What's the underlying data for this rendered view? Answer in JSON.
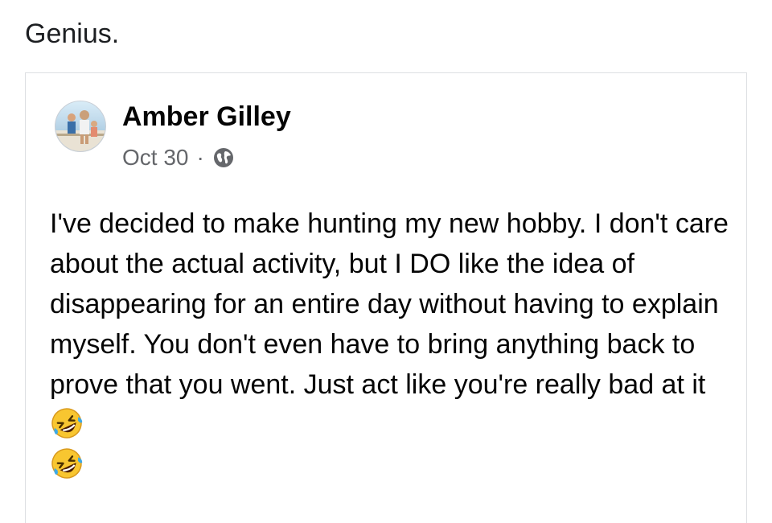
{
  "caption": "Genius.",
  "post": {
    "author": "Amber Gilley",
    "date": "Oct 30",
    "separator": "·",
    "privacy_icon": "globe-icon",
    "text": "I've decided to make hunting my new hobby. I don't care about the actual activity, but I DO like the idea of disappearing for an entire day without having to explain myself. You don't even have to bring anything back to prove that you went. Just act like you're really bad at it",
    "emojis": [
      "rolling-on-floor-laughing-emoji",
      "rolling-on-floor-laughing-emoji"
    ]
  },
  "colors": {
    "secondary_text": "#65676b",
    "border": "#dddfe2",
    "emoji_face": "#f8c630",
    "emoji_tears": "#3da9e8"
  }
}
